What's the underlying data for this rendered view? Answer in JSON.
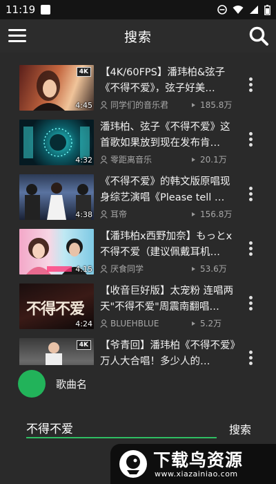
{
  "status_bar": {
    "time": "11:19"
  },
  "app_bar": {
    "title": "搜索"
  },
  "videos": [
    {
      "title": "【4K/60FPS】潘玮柏&弦子《不得不爱》，弦子好美…",
      "author": "同学们的音乐君",
      "views": "185.8万",
      "duration": "4:45",
      "badge": "4K"
    },
    {
      "title": "潘玮柏、弦子《不得不爱》这首歌如果放到现在发布肯…",
      "author": "零距离音乐",
      "views": "20.1万",
      "duration": "4:32"
    },
    {
      "title": "《不得不爱》的韩文版原唱现身综艺演唱《Please tell …",
      "author": "耳帝",
      "views": "156.8万",
      "duration": "4:38"
    },
    {
      "title": "【潘玮柏x西野加奈】もっとx 不得不爱（建议佩戴耳机…",
      "author": "厌食同学",
      "views": "53.6万",
      "duration": "4:15"
    },
    {
      "title": "【收音巨好版】太宠粉 连唱两天\"不得不爱\"周震南翻唱…",
      "author": "BLUEHBLUE",
      "views": "5.2万",
      "duration": "4:24",
      "thumb_text": "不得不爱"
    },
    {
      "title": "【爷青回】潘玮柏《不得不爱》万人大合唱！多少人的…",
      "author": "",
      "views": "",
      "duration": "",
      "badge": "4K"
    }
  ],
  "player": {
    "song_name": "歌曲名"
  },
  "search": {
    "query": "不得不爱",
    "button_label": "搜索"
  },
  "watermark": {
    "text": "下载鸟资源",
    "url": "www.xiazainiao.com"
  },
  "colors": {
    "accent": "#2fbf63",
    "background": "#2a2a2a",
    "app_bar": "#2c2c2c"
  }
}
